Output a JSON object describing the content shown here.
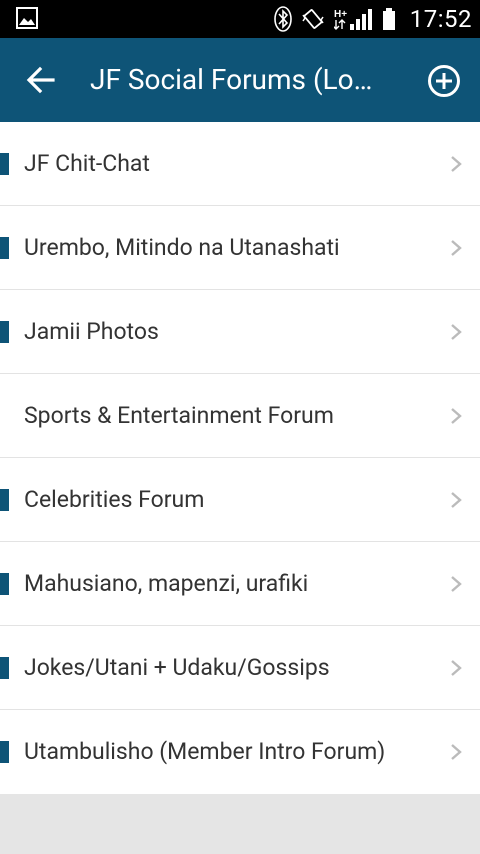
{
  "status_bar": {
    "time": "17:52",
    "icons": [
      "gallery-icon",
      "bluetooth-icon",
      "vibrate-icon",
      "signal-hplus-icon",
      "battery-icon"
    ]
  },
  "toolbar": {
    "title": "JF Social Forums (Lo…",
    "back_icon": "arrow-left-icon",
    "add_icon": "add-circle-icon"
  },
  "forums": [
    {
      "label": "JF Chit-Chat",
      "marker": true
    },
    {
      "label": "Urembo, Mitindo na Utanashati",
      "marker": true
    },
    {
      "label": "Jamii Photos",
      "marker": true
    },
    {
      "label": "Sports & Entertainment Forum",
      "marker": false
    },
    {
      "label": "Celebrities Forum",
      "marker": true
    },
    {
      "label": "Mahusiano, mapenzi, urafiki",
      "marker": true
    },
    {
      "label": "Jokes/Utani + Udaku/Gossips",
      "marker": true
    },
    {
      "label": "Utambulisho (Member Intro Forum)",
      "marker": true
    }
  ],
  "colors": {
    "accent": "#0e5477",
    "status_bar": "#000000",
    "background": "#e5e5e5"
  }
}
